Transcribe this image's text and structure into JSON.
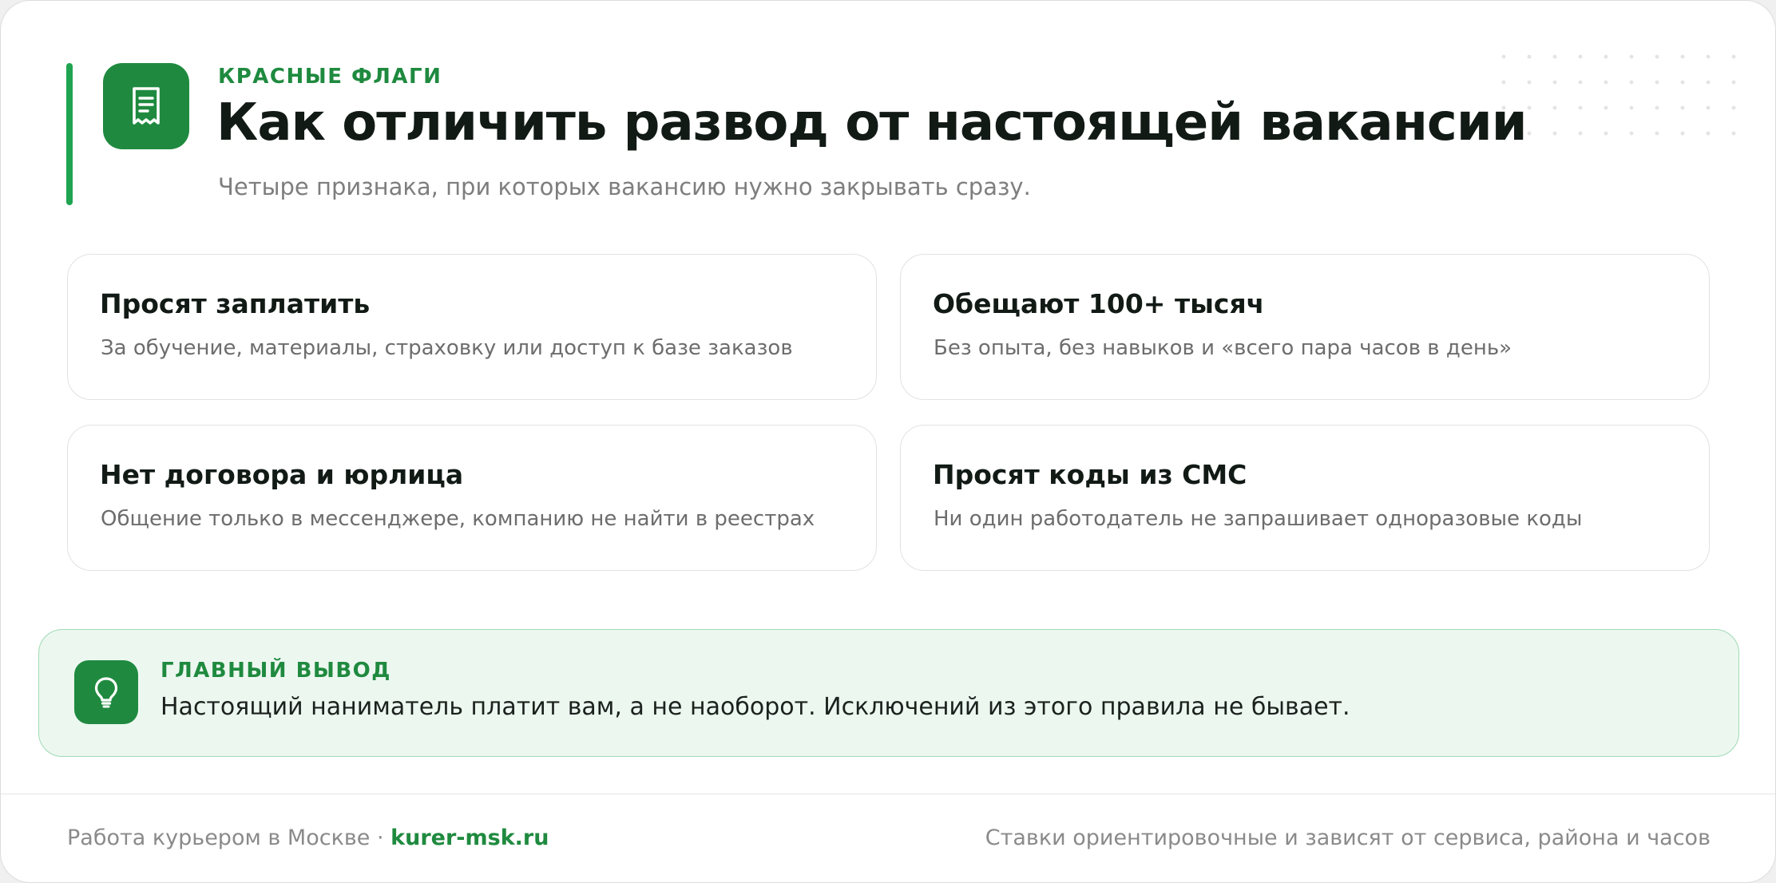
{
  "header": {
    "eyebrow": "КРАСНЫЕ ФЛАГИ",
    "title": "Как отличить развод от настоящей вакансии",
    "subtitle": "Четыре признака, при которых вакансию нужно закрывать сразу.",
    "icon": "receipt-icon"
  },
  "flags": [
    {
      "title": "Просят заплатить",
      "description": "За обучение, материалы, страховку или доступ к базе заказов"
    },
    {
      "title": "Обещают 100+ тысяч",
      "description": "Без опыта, без навыков и «всего пара часов в день»"
    },
    {
      "title": "Нет договора и юрлица",
      "description": "Общение только в мессенджере, компанию не найти в реестрах"
    },
    {
      "title": "Просят коды из СМС",
      "description": "Ни один работодатель не запрашивает одноразовые коды"
    }
  ],
  "conclusion": {
    "label": "ГЛАВНЫЙ ВЫВОД",
    "text": "Настоящий наниматель платит вам, а не наоборот. Исключений из этого правила не бывает.",
    "icon": "lightbulb-icon"
  },
  "footer": {
    "left_text": "Работа курьером в Москве · ",
    "site": "kurer-msk.ru",
    "right_text": "Ставки ориентировочные и зависят от сервиса, района и часов"
  },
  "colors": {
    "accent": "#1f8a3f",
    "accent_bar": "#20a451",
    "conclusion_bg": "#ecf7f0",
    "conclusion_border": "#9fdab4"
  }
}
